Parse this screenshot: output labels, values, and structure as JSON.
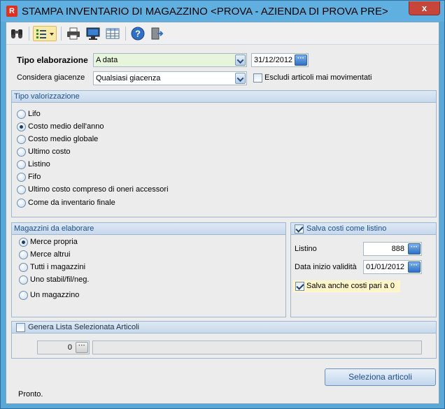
{
  "window": {
    "title": "STAMPA INVENTARIO DI MAGAZZINO <PROVA - AZIENDA DI PROVA PRE>",
    "close_label": "x",
    "app_icon": "app-icon"
  },
  "toolbar": {
    "icons": [
      "binoculars-icon",
      "list-view-dropdown-icon",
      "printer-icon",
      "monitor-preview-icon",
      "spreadsheet-icon",
      "help-icon",
      "exit-icon"
    ]
  },
  "form": {
    "tipo_elaborazione_label": "Tipo elaborazione",
    "tipo_elaborazione_value": "A data",
    "data_value": "31/12/2012",
    "considera_giacenze_label": "Considera giacenze",
    "considera_giacenze_value": "Qualsiasi giacenza",
    "escludi_label": "Escludi articoli mai movimentati",
    "escludi_checked": false
  },
  "valorizzazione": {
    "title": "Tipo valorizzazione",
    "options": [
      {
        "label": "Lifo",
        "checked": false
      },
      {
        "label": "Costo medio dell'anno",
        "checked": true
      },
      {
        "label": "Costo medio globale",
        "checked": false
      },
      {
        "label": "Ultimo costo",
        "checked": false
      },
      {
        "label": "Listino",
        "checked": false
      },
      {
        "label": "Fifo",
        "checked": false
      },
      {
        "label": "Ultimo costo compreso di oneri accessori",
        "checked": false
      },
      {
        "label": "Come da inventario finale",
        "checked": false
      }
    ]
  },
  "magazzini": {
    "title": "Magazzini da elaborare",
    "options": [
      {
        "label": "Merce propria",
        "checked": true
      },
      {
        "label": "Merce altrui",
        "checked": false
      },
      {
        "label": "Tutti i magazzini",
        "checked": false
      },
      {
        "label": "Uno stabil/fil/neg.",
        "checked": false
      },
      {
        "label": "Un magazzino",
        "checked": false
      }
    ]
  },
  "costi": {
    "title": "Salva costi come listino",
    "checked": true,
    "listino_label": "Listino",
    "listino_value": "888",
    "data_inizio_label": "Data inizio validità",
    "data_inizio_value": "01/01/2012",
    "salva_zero_label": "Salva anche costi pari a 0",
    "salva_zero_checked": true
  },
  "lista": {
    "title": "Genera Lista Selezionata Articoli",
    "checked": false,
    "code_value": "0",
    "description_value": ""
  },
  "actions": {
    "seleziona_label": "Seleziona articoli"
  },
  "status": {
    "text": "Pronto."
  },
  "colors": {
    "title_bar": "#5fb0e0",
    "close_button": "#c7463c",
    "group_title": "#1e4f8a",
    "highlight_field": "#e6f5dc",
    "highlight_label": "#fff5c8"
  }
}
